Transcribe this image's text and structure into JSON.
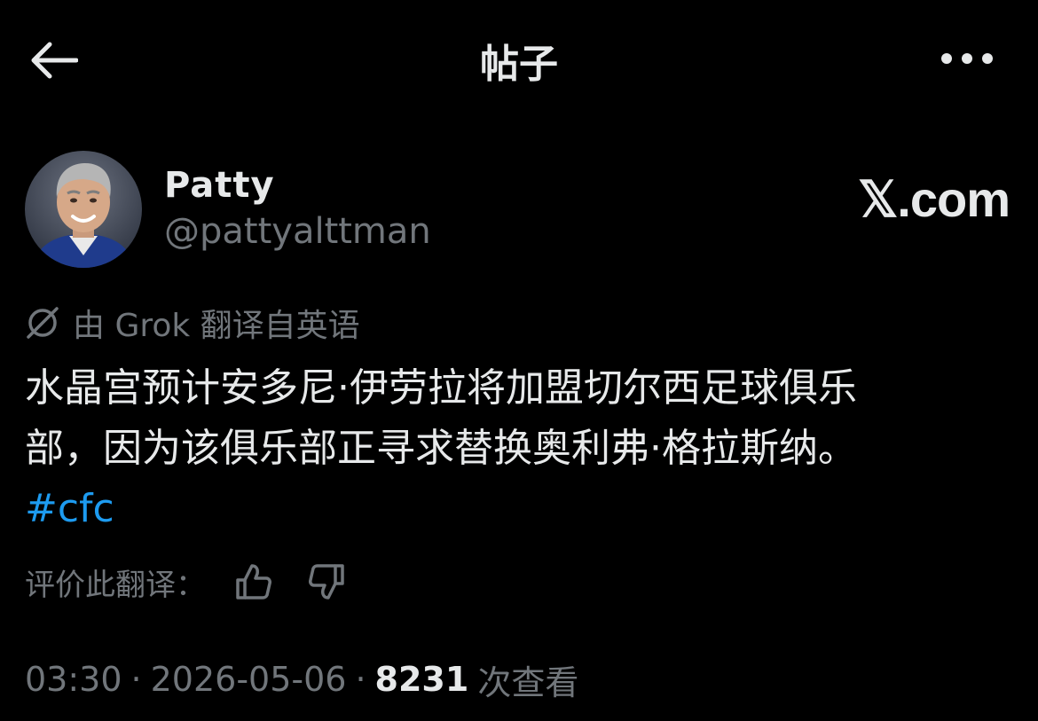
{
  "header": {
    "title": "帖子",
    "back_icon": "arrow-left-icon",
    "more_icon": "more-horizontal-icon"
  },
  "author": {
    "display_name": "Patty",
    "handle": "@pattyalttman",
    "avatar_icon": "profile-avatar"
  },
  "brand": {
    "logo_text": "𝕏.com"
  },
  "translation": {
    "icon": "grok-icon",
    "note": "由 Grok 翻译自英语",
    "rate_label": "评价此翻译："
  },
  "post": {
    "line1": "水晶宫预计安多尼·伊劳拉将加盟切尔西足球俱乐",
    "line2": "部，因为该俱乐部正寻求替换奥利弗·格拉斯纳。",
    "hashtag": "#cfc"
  },
  "meta": {
    "time": "03:30",
    "separator": "·",
    "date": "2026-05-06",
    "views_count": "8231",
    "views_label": "次查看"
  },
  "colors": {
    "background": "#000000",
    "text_primary": "#e7e9ea",
    "text_secondary": "#71767b",
    "link": "#1d9bf0"
  }
}
